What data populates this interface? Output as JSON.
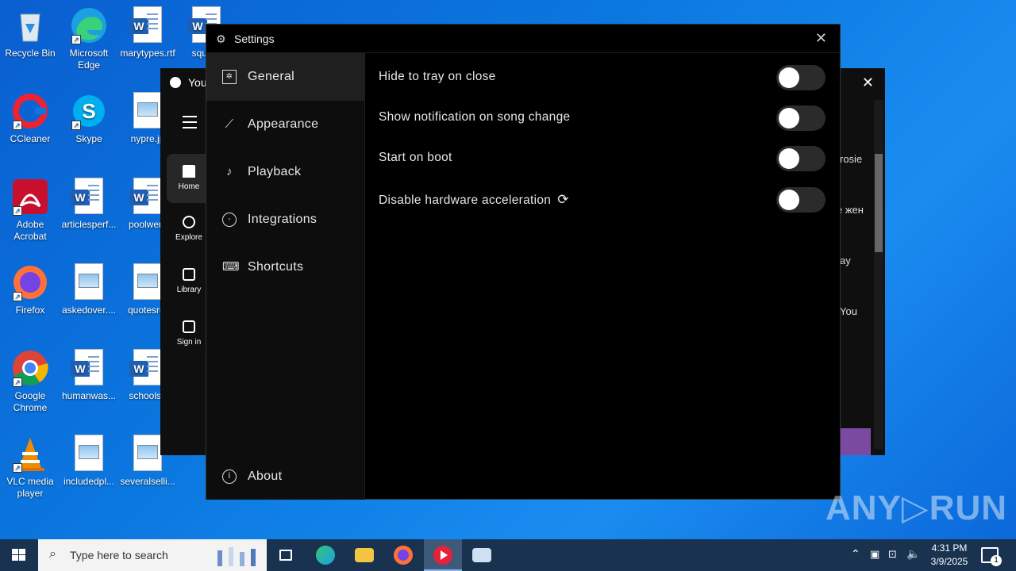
{
  "desktop": {
    "icons": [
      {
        "label": "Recycle Bin"
      },
      {
        "label": "Microsoft Edge"
      },
      {
        "label": "marytypes.rtf"
      },
      {
        "label": "square"
      },
      {
        "label": "CCleaner"
      },
      {
        "label": "Skype"
      },
      {
        "label": "nypre.jp"
      },
      {
        "label": "Adobe Acrobat"
      },
      {
        "label": "articlesperf..."
      },
      {
        "label": "poolwent"
      },
      {
        "label": "Firefox"
      },
      {
        "label": "askedover...."
      },
      {
        "label": "quotesret"
      },
      {
        "label": "Google Chrome"
      },
      {
        "label": "humanwas..."
      },
      {
        "label": "schoolse"
      },
      {
        "label": "VLC media player"
      },
      {
        "label": "includedpl..."
      },
      {
        "label": "severalselli..."
      }
    ]
  },
  "background_window": {
    "title": "You",
    "nav": [
      {
        "label": "Home"
      },
      {
        "label": "Explore"
      },
      {
        "label": "Library"
      },
      {
        "label": "Sign in"
      }
    ],
    "side_texts": [
      "rosie",
      "е жен",
      "ay",
      "You"
    ]
  },
  "settings": {
    "title": "Settings",
    "nav": [
      {
        "label": "General",
        "icon": "general-icon"
      },
      {
        "label": "Appearance",
        "icon": "brush-icon"
      },
      {
        "label": "Playback",
        "icon": "music-note-icon"
      },
      {
        "label": "Integrations",
        "icon": "integrations-icon"
      },
      {
        "label": "Shortcuts",
        "icon": "keyboard-icon"
      },
      {
        "label": "About",
        "icon": "info-icon"
      }
    ],
    "active_nav": "General",
    "options": [
      {
        "label": "Hide to tray on close",
        "enabled": false
      },
      {
        "label": "Show notification on song change",
        "enabled": false
      },
      {
        "label": "Start on boot",
        "enabled": false
      },
      {
        "label": "Disable hardware acceleration",
        "enabled": false,
        "requires_restart_icon": "reload-icon"
      }
    ]
  },
  "watermark": {
    "text": "ANY▷RUN"
  },
  "taskbar": {
    "search_placeholder": "Type here to search",
    "clock_time": "4:31 PM",
    "clock_date": "3/9/2025",
    "notification_count": "1"
  },
  "colors": {
    "settings_bg": "#000000",
    "nav_active": "#1f1f1f",
    "toggle_off": "#2b2b2b",
    "desktop_blue": "#0b78e0",
    "taskbar": "#18324f"
  }
}
